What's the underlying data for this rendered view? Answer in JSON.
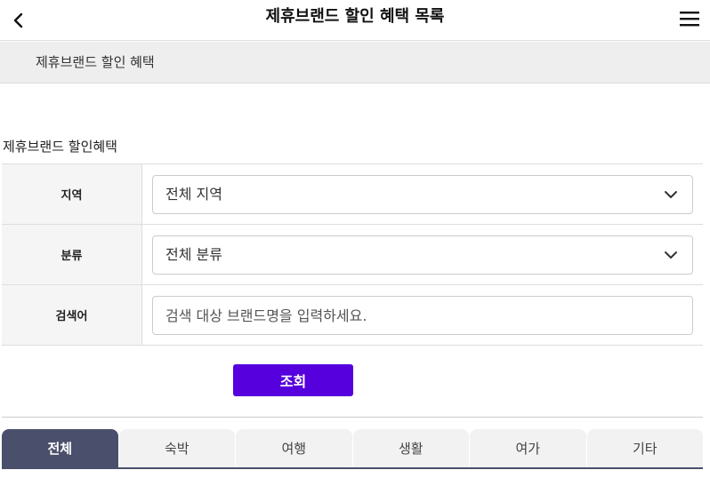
{
  "header": {
    "title": "제휴브랜드 할인 혜택 목록",
    "back_icon": "chevron-left-icon",
    "menu_icon": "hamburger-menu-icon"
  },
  "breadcrumb": {
    "text": "제휴브랜드 할인 혜택"
  },
  "section": {
    "title": "제휴브랜드 할인혜택"
  },
  "form": {
    "region": {
      "label": "지역",
      "value": "전체 지역"
    },
    "category": {
      "label": "분류",
      "value": "전체 분류"
    },
    "keyword": {
      "label": "검색어",
      "placeholder": "검색 대상 브랜드명을 입력하세요.",
      "value": ""
    }
  },
  "search_button": {
    "label": "조회"
  },
  "tabs": [
    {
      "label": "전체",
      "active": true
    },
    {
      "label": "숙박",
      "active": false
    },
    {
      "label": "여행",
      "active": false
    },
    {
      "label": "생활",
      "active": false
    },
    {
      "label": "여가",
      "active": false
    },
    {
      "label": "기타",
      "active": false
    }
  ],
  "colors": {
    "accent": "#5500dd",
    "active_tab": "#4a4f6b",
    "label_bg": "#f5f5f5",
    "breadcrumb_bg": "#eeeeee"
  }
}
